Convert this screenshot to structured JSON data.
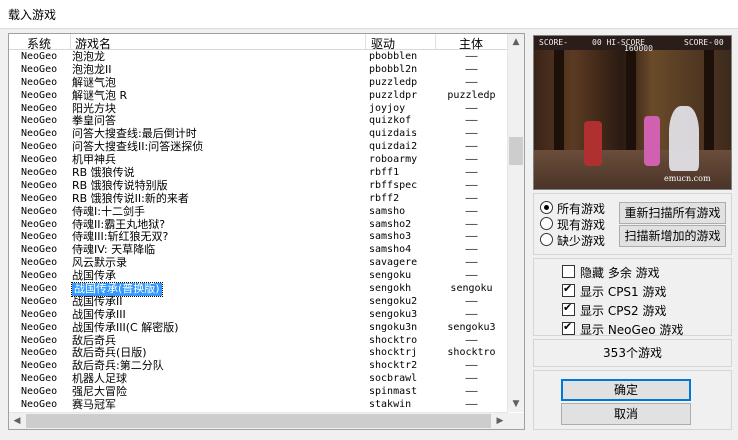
{
  "window": {
    "title": "载入游戏"
  },
  "list": {
    "columns": {
      "system": "系统",
      "name": "游戏名",
      "driver": "驱动",
      "master": "主体"
    },
    "rows": [
      {
        "system": "NeoGeo",
        "name": "泡泡龙",
        "driver": "pbobblen",
        "master": "——"
      },
      {
        "system": "NeoGeo",
        "name": "泡泡龙II",
        "driver": "pbobbl2n",
        "master": "——"
      },
      {
        "system": "NeoGeo",
        "name": "解谜气泡",
        "driver": "puzzledp",
        "master": "——"
      },
      {
        "system": "NeoGeo",
        "name": "解谜气泡 R",
        "driver": "puzzldpr",
        "master": "puzzledp"
      },
      {
        "system": "NeoGeo",
        "name": "阳光方块",
        "driver": "joyjoy",
        "master": "——"
      },
      {
        "system": "NeoGeo",
        "name": "拳皇问答",
        "driver": "quizkof",
        "master": "——"
      },
      {
        "system": "NeoGeo",
        "name": "问答大搜查线:最后倒计时",
        "driver": "quizdais",
        "master": "——"
      },
      {
        "system": "NeoGeo",
        "name": "问答大搜查线II:问答迷探侦",
        "driver": "quizdai2",
        "master": "——"
      },
      {
        "system": "NeoGeo",
        "name": "机甲神兵",
        "driver": "roboarmy",
        "master": "——"
      },
      {
        "system": "NeoGeo",
        "name": "RB 饿狼传说",
        "driver": "rbff1",
        "master": "——"
      },
      {
        "system": "NeoGeo",
        "name": "RB 饿狼传说特别版",
        "driver": "rbffspec",
        "master": "——"
      },
      {
        "system": "NeoGeo",
        "name": "RB 饿狼传说II:新的来者",
        "driver": "rbff2",
        "master": "——"
      },
      {
        "system": "NeoGeo",
        "name": "侍魂I:十二剑手",
        "driver": "samsho",
        "master": "——"
      },
      {
        "system": "NeoGeo",
        "name": "侍魂II:霸王丸地狱?",
        "driver": "samsho2",
        "master": "——"
      },
      {
        "system": "NeoGeo",
        "name": "侍魂III:斩红狼无双?",
        "driver": "samsho3",
        "master": "——"
      },
      {
        "system": "NeoGeo",
        "name": "侍魂IV: 天草降临",
        "driver": "samsho4",
        "master": "——"
      },
      {
        "system": "NeoGeo",
        "name": "风云默示录",
        "driver": "savagere",
        "master": "——"
      },
      {
        "system": "NeoGeo",
        "name": "战国传承",
        "driver": "sengoku",
        "master": "——"
      },
      {
        "system": "NeoGeo",
        "name": "战国传承(普换版)",
        "driver": "sengokh",
        "master": "sengoku",
        "selected": true
      },
      {
        "system": "NeoGeo",
        "name": "战国传承II",
        "driver": "sengoku2",
        "master": "——"
      },
      {
        "system": "NeoGeo",
        "name": "战国传承III",
        "driver": "sengoku3",
        "master": "——"
      },
      {
        "system": "NeoGeo",
        "name": "战国传承III(C 解密版)",
        "driver": "sngoku3n",
        "master": "sengoku3"
      },
      {
        "system": "NeoGeo",
        "name": "敌后奇兵",
        "driver": "shocktro",
        "master": "——"
      },
      {
        "system": "NeoGeo",
        "name": "敌后奇兵(日版)",
        "driver": "shocktrj",
        "master": "shocktro"
      },
      {
        "system": "NeoGeo",
        "name": "敌后奇兵:第二分队",
        "driver": "shocktr2",
        "master": "——"
      },
      {
        "system": "NeoGeo",
        "name": "机器人足球",
        "driver": "socbrawl",
        "master": "——"
      },
      {
        "system": "NeoGeo",
        "name": "强尼大冒险",
        "driver": "spinmast",
        "master": "——"
      },
      {
        "system": "NeoGeo",
        "name": "赛马冠军",
        "driver": "stakwin",
        "master": "——"
      }
    ]
  },
  "preview": {
    "score_left": "SCORE-",
    "score_mid": "00 HI-SCORE",
    "hiscore": "160000",
    "score_right": "SCORE-",
    "score_right_val": "00",
    "watermark": "emucn.com"
  },
  "filter": {
    "radios": [
      {
        "label": "所有游戏",
        "checked": true
      },
      {
        "label": "现有游戏",
        "checked": false
      },
      {
        "label": "缺少游戏",
        "checked": false
      }
    ],
    "rescan_all": "重新扫描所有游戏",
    "rescan_new": "扫描新增加的游戏"
  },
  "options": {
    "checks": [
      {
        "label": "隐藏 多余 游戏",
        "checked": false
      },
      {
        "label": "显示 CPS1 游戏",
        "checked": true
      },
      {
        "label": "显示 CPS2 游戏",
        "checked": true
      },
      {
        "label": "显示 NeoGeo 游戏",
        "checked": true
      }
    ]
  },
  "count": "353个游戏",
  "buttons": {
    "ok": "确定",
    "cancel": "取消"
  }
}
